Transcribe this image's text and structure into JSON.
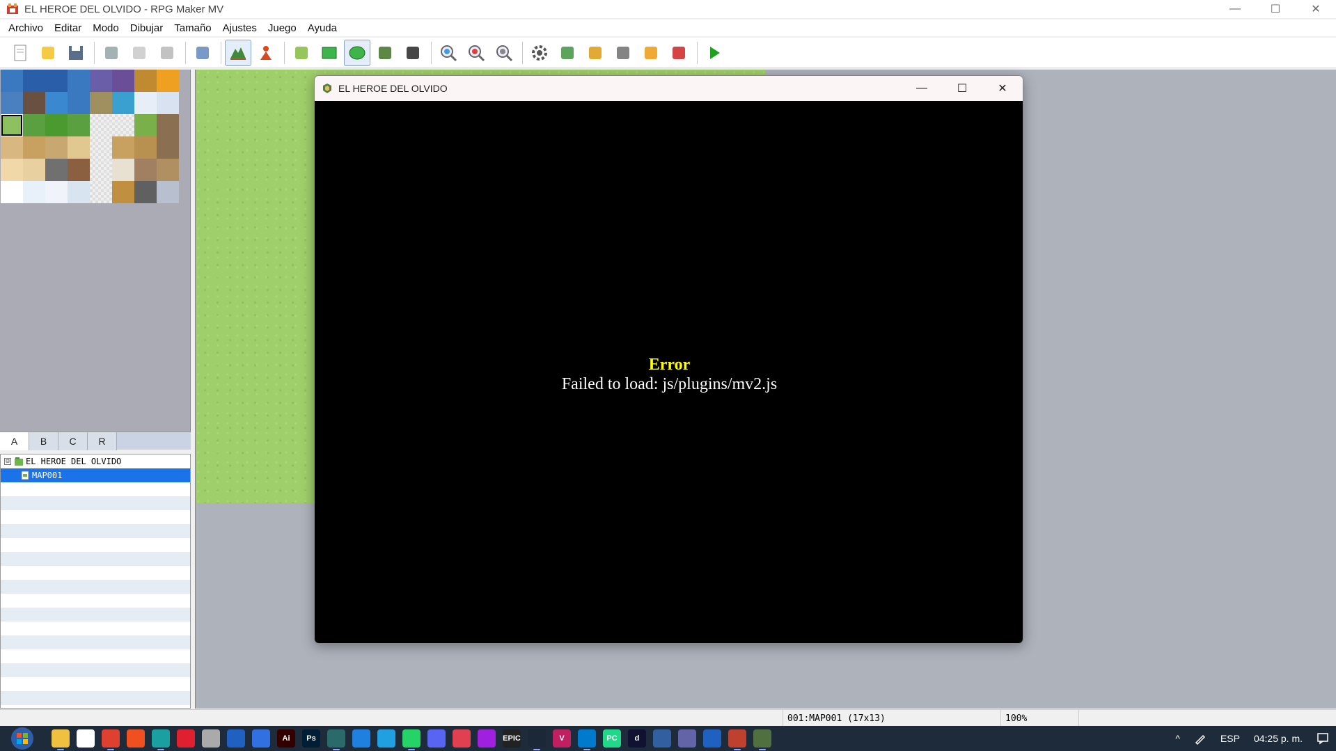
{
  "window": {
    "title": "EL HEROE DEL OLVIDO - RPG Maker MV",
    "minimize": "—",
    "maximize": "☐",
    "close": "✕"
  },
  "menu": [
    "Archivo",
    "Editar",
    "Modo",
    "Dibujar",
    "Tamaño",
    "Ajustes",
    "Juego",
    "Ayuda"
  ],
  "toolbar": {
    "tools": [
      {
        "name": "new-project-icon",
        "color": "#ffffff"
      },
      {
        "name": "open-project-icon",
        "color": "#f4c430"
      },
      {
        "name": "save-project-icon",
        "color": "#5a6e8c"
      },
      {
        "name": "cut-icon",
        "color": "#9aa"
      },
      {
        "name": "copy-icon",
        "color": "#ccc"
      },
      {
        "name": "paste-icon",
        "color": "#bbb"
      },
      {
        "name": "undo-icon",
        "color": "#6a8fc0"
      },
      {
        "name": "map-mode-icon",
        "color": "#3f8a3a"
      },
      {
        "name": "event-mode-icon",
        "color": "#d64a1e"
      },
      {
        "name": "pencil-icon",
        "color": "#8ac04a"
      },
      {
        "name": "rectangle-icon",
        "color": "#3fb44a"
      },
      {
        "name": "ellipse-icon",
        "color": "#3fb44a"
      },
      {
        "name": "fill-icon",
        "color": "#4a7a30"
      },
      {
        "name": "shadow-pen-icon",
        "color": "#333"
      },
      {
        "name": "zoom-in-icon",
        "color": "#3fa0e0"
      },
      {
        "name": "zoom-out-icon",
        "color": "#e04040"
      },
      {
        "name": "zoom-actual-icon",
        "color": "#888"
      },
      {
        "name": "database-icon",
        "color": "#555"
      },
      {
        "name": "plugin-manager-icon",
        "color": "#4a9a4a"
      },
      {
        "name": "sound-test-icon",
        "color": "#e0a020"
      },
      {
        "name": "event-searcher-icon",
        "color": "#777"
      },
      {
        "name": "resource-manager-icon",
        "color": "#f0a020"
      },
      {
        "name": "character-generator-icon",
        "color": "#d03030"
      },
      {
        "name": "playtest-icon",
        "color": "#20a020"
      }
    ]
  },
  "tabs": [
    "A",
    "B",
    "C",
    "R"
  ],
  "active_tab": "A",
  "maptree": {
    "project": "EL HEROE DEL OLVIDO",
    "expand_symbol": "⊟",
    "maps": [
      "MAP001"
    ]
  },
  "game_window": {
    "title": "EL HEROE DEL OLVIDO",
    "minimize": "—",
    "maximize": "☐",
    "close": "✕",
    "error_title": "Error",
    "error_message": "Failed to load: js/plugins/mv2.js"
  },
  "status": {
    "map_info": "001:MAP001 (17x13)",
    "zoom": "100%"
  },
  "taskbar": {
    "apps": [
      {
        "name": "file-explorer-icon",
        "color": "#f0c040",
        "label": ""
      },
      {
        "name": "microsoft-store-icon",
        "color": "#ffffff",
        "label": ""
      },
      {
        "name": "chrome-icon",
        "color": "#e04030",
        "label": ""
      },
      {
        "name": "brave-icon",
        "color": "#f05020",
        "label": ""
      },
      {
        "name": "edge-icon",
        "color": "#1aa0a0",
        "label": ""
      },
      {
        "name": "opera-icon",
        "color": "#e02030",
        "label": ""
      },
      {
        "name": "castle-app-icon",
        "color": "#aaaaaa",
        "label": ""
      },
      {
        "name": "app-blue-icon",
        "color": "#2060c0",
        "label": ""
      },
      {
        "name": "app-image-icon",
        "color": "#3070e0",
        "label": ""
      },
      {
        "name": "illustrator-icon",
        "color": "#330000",
        "label": "Ai"
      },
      {
        "name": "photoshop-icon",
        "color": "#001e36",
        "label": "Ps"
      },
      {
        "name": "terminal-app-icon",
        "color": "#2a6a6a",
        "label": ""
      },
      {
        "name": "app-blue2-icon",
        "color": "#2080e0",
        "label": ""
      },
      {
        "name": "app-cyan-icon",
        "color": "#20a0e0",
        "label": ""
      },
      {
        "name": "whatsapp-icon",
        "color": "#25d366",
        "label": ""
      },
      {
        "name": "discord-icon",
        "color": "#5865f2",
        "label": ""
      },
      {
        "name": "app-red-icon",
        "color": "#e04050",
        "label": ""
      },
      {
        "name": "app-purple-icon",
        "color": "#a020e0",
        "label": ""
      },
      {
        "name": "epic-games-icon",
        "color": "#222222",
        "label": "EPIC"
      },
      {
        "name": "steam-icon",
        "color": "#1b2838",
        "label": ""
      },
      {
        "name": "app-v-icon",
        "color": "#c02060",
        "label": "V"
      },
      {
        "name": "vscode-icon",
        "color": "#007acc",
        "label": ""
      },
      {
        "name": "pycharm-icon",
        "color": "#21d789",
        "label": "PC"
      },
      {
        "name": "app-d-icon",
        "color": "#111133",
        "label": "d"
      },
      {
        "name": "app-grid-icon",
        "color": "#3060a0",
        "label": ""
      },
      {
        "name": "teams-icon",
        "color": "#6264a7",
        "label": ""
      },
      {
        "name": "app-blue3-icon",
        "color": "#2060c0",
        "label": ""
      },
      {
        "name": "rpgmaker-icon",
        "color": "#c04030",
        "label": ""
      },
      {
        "name": "game-icon",
        "color": "#507040",
        "label": ""
      }
    ],
    "language": "ESP",
    "time": "04:25 p. m.",
    "chevron": "^"
  }
}
